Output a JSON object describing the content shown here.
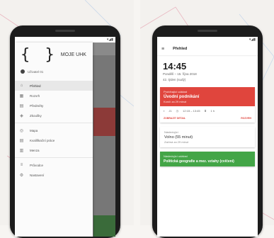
{
  "colors": {
    "background": "#f7f5f2",
    "phone_body": "#1c1c1c",
    "accent_red": "#e0453d",
    "accent_green": "#43a547"
  },
  "left_screen": {
    "status_icons": "▾◢▮",
    "app_name": "MOJE UHK",
    "logo_glyph": "{ }",
    "user_name": "Uživatel 01",
    "menu": [
      {
        "label": "Přehled",
        "icon": "home-icon",
        "glyph": "⌂",
        "active": true
      },
      {
        "label": "Rozvrh",
        "icon": "calendar-icon",
        "glyph": "▦",
        "active": false
      },
      {
        "label": "Předměty",
        "icon": "book-icon",
        "glyph": "▤",
        "active": false
      },
      {
        "label": "Zkoušky",
        "icon": "exam-icon",
        "glyph": "◈",
        "active": false
      },
      {
        "label": "Mapa",
        "icon": "map-icon",
        "glyph": "◎",
        "active": false
      },
      {
        "label": "Kvalifikační práce",
        "icon": "document-icon",
        "glyph": "▤",
        "active": false
      },
      {
        "label": "Menza",
        "icon": "restaurant-icon",
        "glyph": "▥",
        "active": false
      },
      {
        "label": "Průvodce",
        "icon": "guide-icon",
        "glyph": "≡",
        "active": false
      },
      {
        "label": "Nastavení",
        "icon": "settings-icon",
        "glyph": "⚙",
        "active": false
      }
    ]
  },
  "right_screen": {
    "status_icons": "▾◢▮",
    "title": "Přehled",
    "time": "14:45",
    "date": "Pondělí – 15. října 2018",
    "week": "42. týden (sudý)",
    "card_upcoming": {
      "label": "Probíhající událost",
      "title": "Úvodní podnikání",
      "subtitle": "Končí za 29 minut",
      "room": "J1",
      "time_range": "12:15 – 13:45",
      "duration": "1 h",
      "action_left": "ZOBRAZIT DETAIL",
      "action_right": "ROZVRH"
    },
    "card_next": {
      "label": "Následující",
      "title": "Volno (55 minut)",
      "subtitle": "Začíná za 29 minut"
    },
    "card_green": {
      "label": "Následující událost",
      "title": "Politická geografie a mez. vztahy (cvičení)"
    }
  }
}
